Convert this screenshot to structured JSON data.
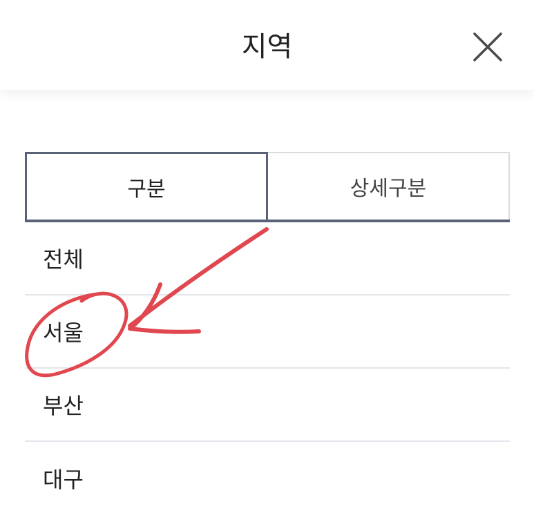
{
  "header": {
    "title": "지역",
    "close_icon": "close-icon"
  },
  "tabs": [
    {
      "label": "구분",
      "active": true
    },
    {
      "label": "상세구분",
      "active": false
    }
  ],
  "list": {
    "items": [
      "전체",
      "서울",
      "부산",
      "대구"
    ]
  },
  "colors": {
    "text": "#222222",
    "tab_active_border": "#5a6277",
    "divider": "#e3e5ea",
    "annotation": "#e0474f"
  },
  "annotation": {
    "type": "hand-drawn circle and arrow",
    "target": "서울"
  }
}
